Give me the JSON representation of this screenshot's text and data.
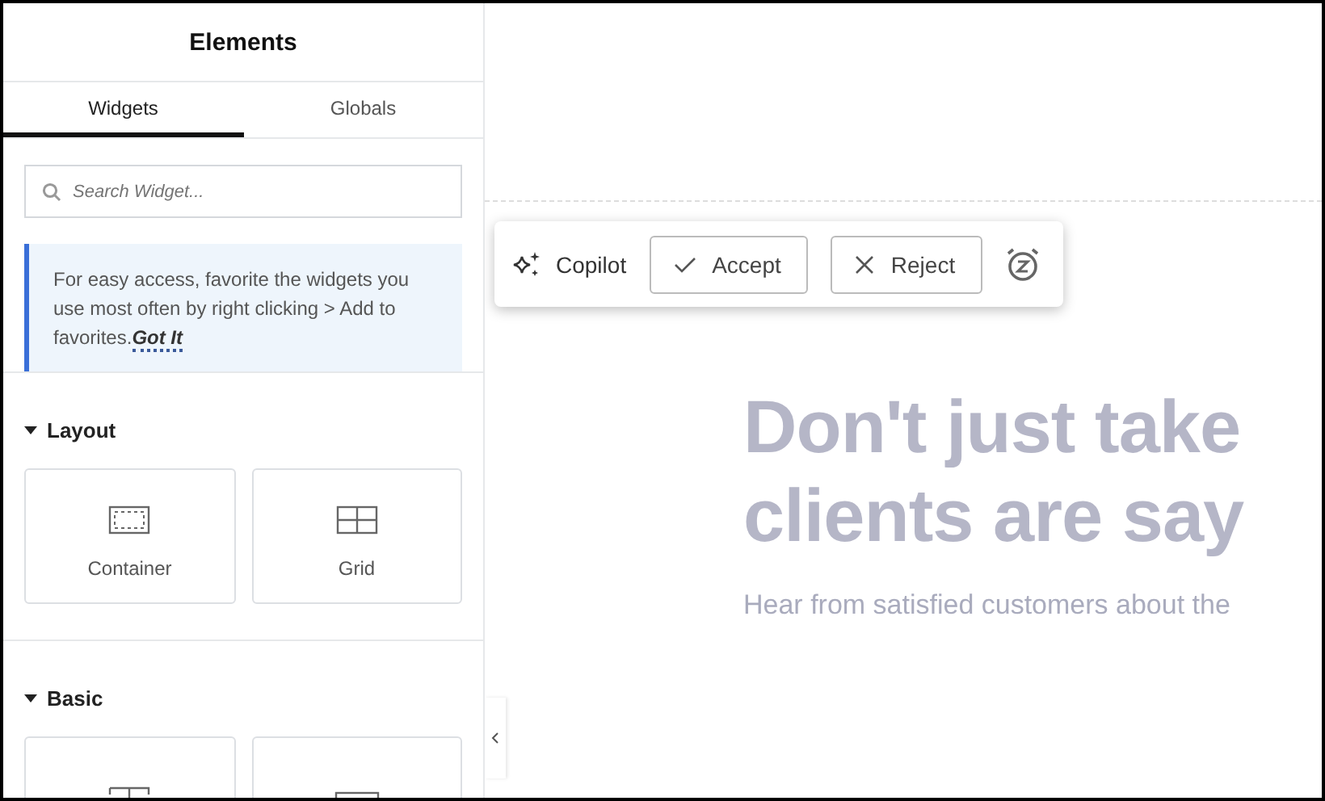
{
  "panel": {
    "title": "Elements",
    "tabs": [
      {
        "label": "Widgets",
        "selected": true
      },
      {
        "label": "Globals",
        "selected": false
      }
    ],
    "search": {
      "placeholder": "Search Widget..."
    },
    "tip": {
      "text": "For easy access, favorite the widgets you use most often by right clicking > Add to favorites.",
      "link": "Got It"
    },
    "categories": [
      {
        "title": "Layout",
        "expanded": true,
        "widgets": [
          {
            "label": "Container",
            "kind": "container"
          },
          {
            "label": "Grid",
            "kind": "grid"
          }
        ]
      },
      {
        "title": "Basic",
        "expanded": true,
        "widgets": [
          {
            "kind": "heading"
          },
          {
            "kind": "image"
          }
        ]
      }
    ]
  },
  "copilot": {
    "label": "Copilot",
    "buttons": [
      {
        "label": "Accept",
        "kind": "accept"
      },
      {
        "label": "Reject",
        "kind": "reject"
      }
    ]
  },
  "canvas": {
    "heading_lines": [
      "Don't just take",
      "clients are say"
    ],
    "subtitle": "Hear from satisfied customers about the"
  }
}
